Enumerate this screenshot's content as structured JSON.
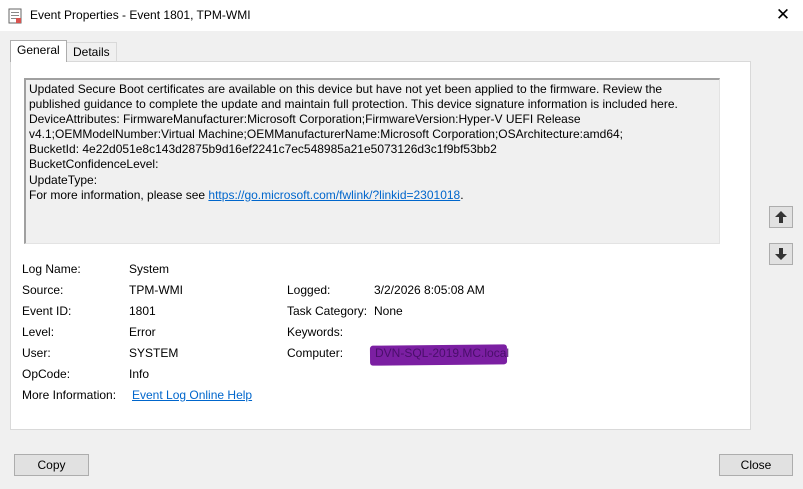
{
  "window": {
    "title": "Event Properties - Event 1801, TPM-WMI",
    "close_glyph": "✕"
  },
  "tabs": [
    {
      "label": "General",
      "active": true
    },
    {
      "label": "Details",
      "active": false
    }
  ],
  "description": {
    "lines": [
      "Updated Secure Boot certificates are available on this device but have not yet been applied to the firmware. Review the published guidance to complete the update and maintain full protection. This device signature information is included here.",
      "DeviceAttributes: FirmwareManufacturer:Microsoft Corporation;FirmwareVersion:Hyper-V UEFI Release v4.1;OEMModelNumber:Virtual Machine;OEMManufacturerName:Microsoft Corporation;OSArchitecture:amd64;",
      "BucketId: 4e22d051e8c143d2875b9d16ef2241c7ec548985a21e5073126d3c1f9bf53bb2",
      "BucketConfidenceLevel:",
      "UpdateType:"
    ],
    "more_info_prefix": "For more information, please see ",
    "more_info_link": "https://go.microsoft.com/fwlink/?linkid=2301018",
    "more_info_suffix": "."
  },
  "fields": {
    "log_name_label": "Log Name:",
    "log_name": "System",
    "source_label": "Source:",
    "source": "TPM-WMI",
    "logged_label": "Logged:",
    "logged": "3/2/2026 8:05:08 AM",
    "event_id_label": "Event ID:",
    "event_id": "1801",
    "task_category_label": "Task Category:",
    "task_category": "None",
    "level_label": "Level:",
    "level": "Error",
    "keywords_label": "Keywords:",
    "keywords": "",
    "user_label": "User:",
    "user": "SYSTEM",
    "computer_label": "Computer:",
    "computer": "DVN-SQL-2019.MC.local",
    "opcode_label": "OpCode:",
    "opcode": "Info",
    "more_information_label": "More Information:",
    "more_information_link": "Event Log Online Help"
  },
  "buttons": {
    "copy": "Copy",
    "close": "Close"
  },
  "colors": {
    "redaction": "#7b1fa2",
    "link": "#0066cc"
  }
}
